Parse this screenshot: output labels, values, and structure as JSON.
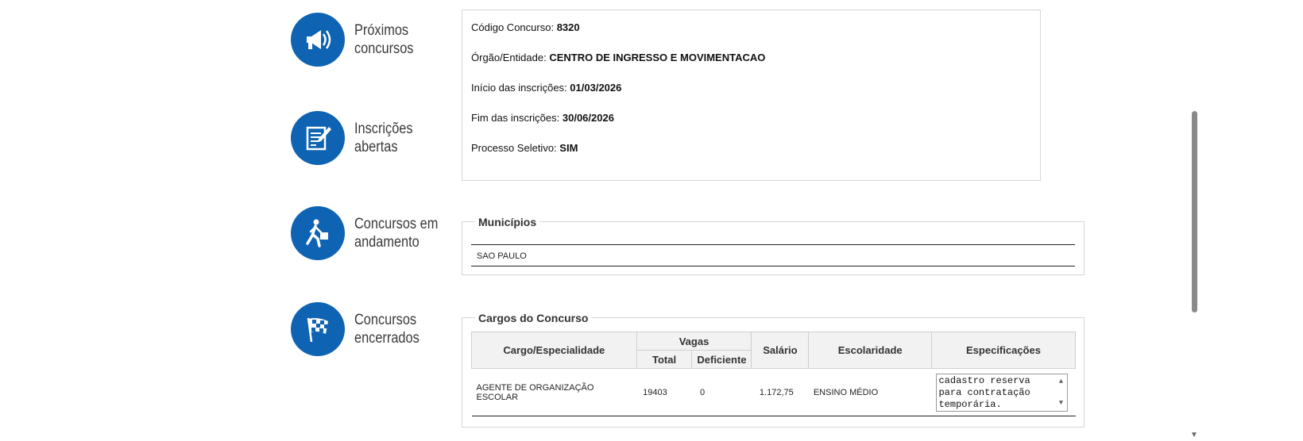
{
  "nav": [
    {
      "line1": "Próximos",
      "line2": "concursos",
      "icon": "megaphone-icon"
    },
    {
      "line1": "Inscrições",
      "line2": "abertas",
      "icon": "document-pen-icon"
    },
    {
      "line1": "Concursos em",
      "line2": "andamento",
      "icon": "walking-man-icon"
    },
    {
      "line1": "Concursos",
      "line2": "encerrados",
      "icon": "checkered-flag-icon"
    }
  ],
  "info": {
    "codigo_label": "Código Concurso:",
    "codigo_value": "8320",
    "orgao_label": "Órgão/Entidade:",
    "orgao_value": "CENTRO DE INGRESSO E MOVIMENTACAO",
    "inicio_label": "Início das inscrições:",
    "inicio_value": "01/03/2026",
    "fim_label": "Fim das inscrições:",
    "fim_value": "30/06/2026",
    "processo_label": "Processo Seletivo:",
    "processo_value": "SIM"
  },
  "municipios": {
    "legend": "Municípios",
    "items": [
      "SAO PAULO"
    ]
  },
  "cargos": {
    "legend": "Cargos do Concurso",
    "headers": {
      "cargo": "Cargo/Especialidade",
      "vagas": "Vagas",
      "total": "Total",
      "deficiente": "Deficiente",
      "salario": "Salário",
      "escolaridade": "Escolaridade",
      "especificacoes": "Especificações"
    },
    "rows": [
      {
        "cargo": "AGENTE DE ORGANIZAÇÃO ESCOLAR",
        "total": "19403",
        "deficiente": "0",
        "salario": "1.172,75",
        "escolaridade": "ENSINO MÉDIO",
        "especificacoes": "cadastro reserva para contratação temporária."
      }
    ]
  },
  "colors": {
    "accent": "#0f63b3"
  }
}
